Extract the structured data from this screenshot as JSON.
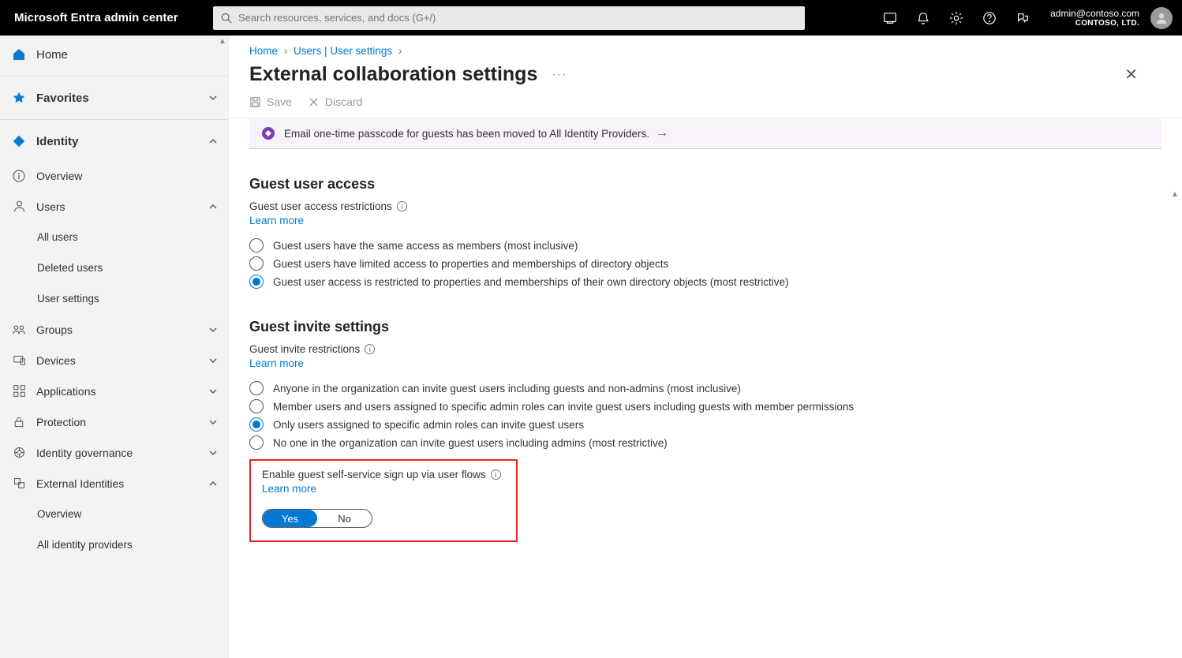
{
  "brand": "Microsoft Entra admin center",
  "search_placeholder": "Search resources, services, and docs (G+/)",
  "account": {
    "email": "admin@contoso.com",
    "tenant": "CONTOSO, LTD."
  },
  "sidebar": {
    "home": "Home",
    "favorites": "Favorites",
    "identity": "Identity",
    "identity_items": {
      "overview": "Overview",
      "users": "Users",
      "users_sub": {
        "all": "All users",
        "deleted": "Deleted users",
        "settings": "User settings"
      },
      "groups": "Groups",
      "devices": "Devices",
      "applications": "Applications",
      "protection": "Protection",
      "igov": "Identity governance",
      "extids": "External Identities",
      "extids_sub": {
        "overview": "Overview",
        "idp": "All identity providers"
      }
    }
  },
  "breadcrumb": {
    "home": "Home",
    "users": "Users | User settings"
  },
  "page_title": "External collaboration settings",
  "toolbar": {
    "save": "Save",
    "discard": "Discard"
  },
  "infobar": "Email one-time passcode for guests has been moved to All Identity Providers.",
  "sec1": {
    "title": "Guest user access",
    "sub": "Guest user access restrictions",
    "learn": "Learn more",
    "opts": [
      "Guest users have the same access as members (most inclusive)",
      "Guest users have limited access to properties and memberships of directory objects",
      "Guest user access is restricted to properties and memberships of their own directory objects (most restrictive)"
    ],
    "selected": 2
  },
  "sec2": {
    "title": "Guest invite settings",
    "sub": "Guest invite restrictions",
    "learn": "Learn more",
    "opts": [
      "Anyone in the organization can invite guest users including guests and non-admins (most inclusive)",
      "Member users and users assigned to specific admin roles can invite guest users including guests with member permissions",
      "Only users assigned to specific admin roles can invite guest users",
      "No one in the organization can invite guest users including admins (most restrictive)"
    ],
    "selected": 2
  },
  "selfservice": {
    "label": "Enable guest self-service sign up via user flows",
    "learn": "Learn more",
    "yes": "Yes",
    "no": "No",
    "value": "Yes"
  }
}
